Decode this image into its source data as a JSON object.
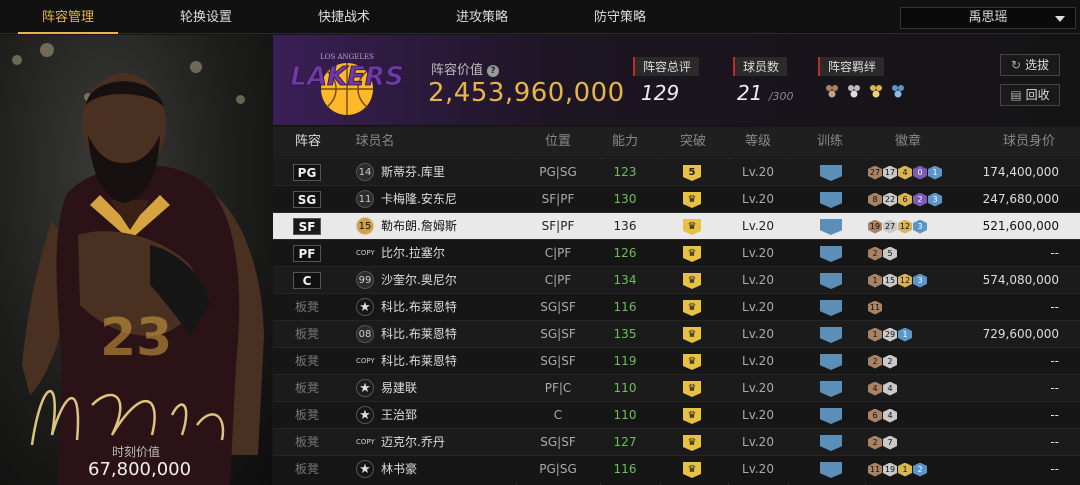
{
  "nav": {
    "tabs": [
      "阵容管理",
      "轮换设置",
      "快捷战术",
      "进攻策略",
      "防守策略"
    ],
    "active": 0,
    "user": "禹思瑶"
  },
  "player_card": {
    "jersey": "23",
    "value_label": "时刻价值",
    "value": "67,800,000"
  },
  "header": {
    "team_logo_text": "LAKERS",
    "team_logo_sub": "LOS ANGELES",
    "lineup_value_label": "阵容价值",
    "lineup_value": "2,453,960,000",
    "rating_label": "阵容总评",
    "rating": "129",
    "count_label": "球员数",
    "count": "21",
    "count_max": "/300",
    "bond_label": "阵容羁绊",
    "btn_switch": "选拔",
    "btn_recycle": "回收",
    "colors": {
      "accent": "#e8b34a",
      "team_purple": "#552583",
      "team_gold": "#fdb927"
    }
  },
  "table": {
    "headers": [
      "阵容",
      "球员名",
      "位置",
      "能力",
      "突破",
      "等级",
      "训练",
      "徽章",
      "球员身价"
    ],
    "rows": [
      {
        "slot": "PG",
        "bench": false,
        "num": "14",
        "num_style": "normal",
        "name": "斯蒂芬.库里",
        "pos": "PG|SG",
        "ability": "123",
        "break": "5",
        "level": "Lv.20",
        "badges": [
          [
            "27",
            "b-br"
          ],
          [
            "17",
            "b-si"
          ],
          [
            "4",
            "b-go"
          ],
          [
            "0",
            "b-pu"
          ],
          [
            "1",
            "b-bl"
          ]
        ],
        "price": "174,400,000"
      },
      {
        "slot": "SG",
        "bench": false,
        "num": "11",
        "num_style": "normal",
        "name": "卡梅隆.安东尼",
        "pos": "SF|PF",
        "ability": "130",
        "break": "♛",
        "level": "Lv.20",
        "badges": [
          [
            "8",
            "b-br"
          ],
          [
            "22",
            "b-si"
          ],
          [
            "6",
            "b-go"
          ],
          [
            "2",
            "b-pu"
          ],
          [
            "3",
            "b-bl"
          ]
        ],
        "price": "247,680,000"
      },
      {
        "slot": "SF",
        "bench": false,
        "num": "15",
        "num_style": "gold",
        "name": "勒布朗.詹姆斯",
        "pos": "SF|PF",
        "ability": "136",
        "break": "♛",
        "level": "Lv.20",
        "badges": [
          [
            "19",
            "b-br"
          ],
          [
            "27",
            "b-si"
          ],
          [
            "12",
            "b-go"
          ],
          [
            "3",
            "b-bl"
          ]
        ],
        "price": "521,600,000",
        "selected": true
      },
      {
        "slot": "PF",
        "bench": false,
        "num": "COPY",
        "num_style": "copy",
        "name": "比尔.拉塞尔",
        "pos": "C|PF",
        "ability": "126",
        "break": "♛",
        "level": "Lv.20",
        "badges": [
          [
            "2",
            "b-br"
          ],
          [
            "5",
            "b-si"
          ]
        ],
        "price": "--"
      },
      {
        "slot": "C",
        "bench": false,
        "num": "99",
        "num_style": "normal",
        "name": "沙奎尔.奥尼尔",
        "pos": "C|PF",
        "ability": "134",
        "break": "♛",
        "level": "Lv.20",
        "badges": [
          [
            "1",
            "b-br"
          ],
          [
            "15",
            "b-si"
          ],
          [
            "12",
            "b-go"
          ],
          [
            "3",
            "b-bl"
          ]
        ],
        "price": "574,080,000"
      },
      {
        "slot": "板凳",
        "bench": true,
        "num": "★",
        "num_style": "star",
        "name": "科比.布莱恩特",
        "pos": "SG|SF",
        "ability": "116",
        "break": "♛",
        "level": "Lv.20",
        "badges": [
          [
            "11",
            "b-br"
          ]
        ],
        "price": "--"
      },
      {
        "slot": "板凳",
        "bench": true,
        "num": "08",
        "num_style": "normal",
        "name": "科比.布莱恩特",
        "pos": "SG|SF",
        "ability": "135",
        "break": "♛",
        "level": "Lv.20",
        "badges": [
          [
            "1",
            "b-br"
          ],
          [
            "29",
            "b-si"
          ],
          [
            "1",
            "b-bl"
          ]
        ],
        "price": "729,600,000"
      },
      {
        "slot": "板凳",
        "bench": true,
        "num": "COPY",
        "num_style": "copy",
        "name": "科比.布莱恩特",
        "pos": "SG|SF",
        "ability": "119",
        "break": "♛",
        "level": "Lv.20",
        "badges": [
          [
            "2",
            "b-br"
          ],
          [
            "2",
            "b-si"
          ]
        ],
        "price": "--"
      },
      {
        "slot": "板凳",
        "bench": true,
        "num": "★",
        "num_style": "star",
        "name": "易建联",
        "pos": "PF|C",
        "ability": "110",
        "break": "♛",
        "level": "Lv.20",
        "badges": [
          [
            "4",
            "b-br"
          ],
          [
            "4",
            "b-si"
          ]
        ],
        "price": "--"
      },
      {
        "slot": "板凳",
        "bench": true,
        "num": "★",
        "num_style": "star",
        "name": "王治郅",
        "pos": "C",
        "ability": "110",
        "break": "♛",
        "level": "Lv.20",
        "badges": [
          [
            "6",
            "b-br"
          ],
          [
            "4",
            "b-si"
          ]
        ],
        "price": "--"
      },
      {
        "slot": "板凳",
        "bench": true,
        "num": "COPY",
        "num_style": "copy",
        "name": "迈克尔.乔丹",
        "pos": "SG|SF",
        "ability": "127",
        "break": "♛",
        "level": "Lv.20",
        "badges": [
          [
            "2",
            "b-br"
          ],
          [
            "7",
            "b-si"
          ]
        ],
        "price": "--"
      },
      {
        "slot": "板凳",
        "bench": true,
        "num": "★",
        "num_style": "star",
        "name": "林书豪",
        "pos": "PG|SG",
        "ability": "116",
        "break": "♛",
        "level": "Lv.20",
        "badges": [
          [
            "11",
            "b-br"
          ],
          [
            "19",
            "b-si"
          ],
          [
            "1",
            "b-go"
          ],
          [
            "2",
            "b-bl"
          ]
        ],
        "price": "--"
      }
    ]
  }
}
